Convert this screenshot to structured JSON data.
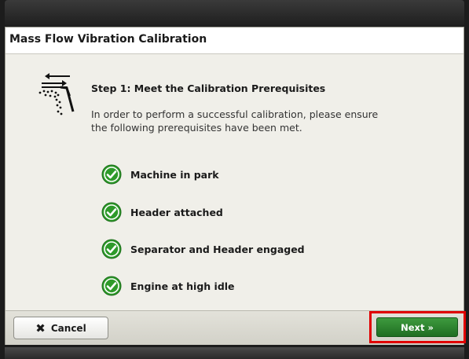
{
  "dialog": {
    "title": "Mass Flow Vibration Calibration"
  },
  "step": {
    "title": "Step 1: Meet the Calibration Prerequisites",
    "description_line1": "In order to perform a successful calibration, please ensure",
    "description_line2": "the following prerequisites have been met.",
    "icon": "mass-flow-sensor-icon"
  },
  "prerequisites": [
    {
      "label": "Machine in park",
      "status": "met"
    },
    {
      "label": "Header attached",
      "status": "met"
    },
    {
      "label": "Separator and Header engaged",
      "status": "met"
    },
    {
      "label": "Engine at high idle",
      "status": "met"
    }
  ],
  "footer": {
    "cancel_label": "Cancel",
    "next_label": "Next »"
  },
  "colors": {
    "check_green": "#2e9a2a",
    "next_button": "#2a842d",
    "highlight": "#e00000"
  }
}
